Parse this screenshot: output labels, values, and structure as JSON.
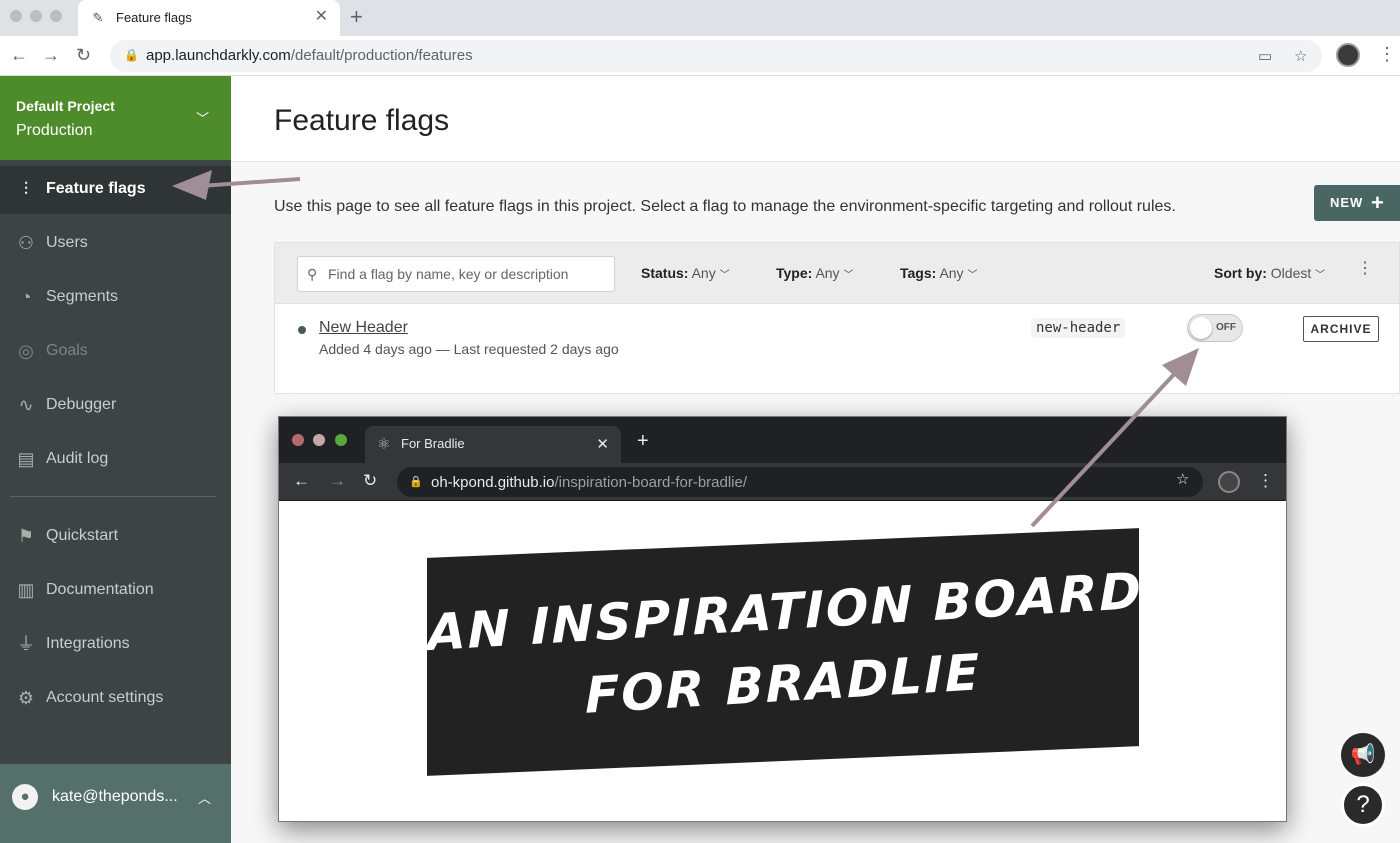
{
  "browser": {
    "tab_title": "Feature flags",
    "tab_close": "✕",
    "new_tab": "+",
    "url_host": "app.launchdarkly.com",
    "url_path": "/default/production/features"
  },
  "sidebar": {
    "project_name": "Default Project",
    "environment": "Production",
    "items": [
      {
        "label": "Feature flags",
        "icon": "sliders-icon"
      },
      {
        "label": "Users",
        "icon": "users-icon"
      },
      {
        "label": "Segments",
        "icon": "pie-chart-icon"
      },
      {
        "label": "Goals",
        "icon": "target-icon"
      },
      {
        "label": "Debugger",
        "icon": "pulse-icon"
      },
      {
        "label": "Audit log",
        "icon": "audit-icon"
      },
      {
        "label": "Quickstart",
        "icon": "signpost-icon"
      },
      {
        "label": "Documentation",
        "icon": "book-icon"
      },
      {
        "label": "Integrations",
        "icon": "plug-icon"
      },
      {
        "label": "Account settings",
        "icon": "gear-icon"
      }
    ],
    "user_email": "kate@theponds..."
  },
  "main": {
    "title": "Feature flags",
    "description": "Use this page to see all feature flags in this project. Select a flag to manage the environment-specific targeting and rollout rules.",
    "new_button": "NEW",
    "search_placeholder": "Find a flag by name, key or description",
    "filters": {
      "status_label": "Status:",
      "status_value": "Any",
      "type_label": "Type:",
      "type_value": "Any",
      "tags_label": "Tags:",
      "tags_value": "Any",
      "sort_label": "Sort by:",
      "sort_value": "Oldest"
    },
    "flag": {
      "name": "New Header",
      "meta": "Added 4 days ago — Last requested 2 days ago",
      "key": "new-header",
      "toggle_state": "OFF",
      "archive_label": "ARCHIVE"
    }
  },
  "preview": {
    "tab_title": "For Bradlie",
    "tab_close": "✕",
    "new_tab": "+",
    "url_host": "oh-kpond.github.io",
    "url_path": "/inspiration-board-for-bradlie/",
    "banner_line1": "AN INSPIRATION BOARD",
    "banner_line2": "FOR BRADLIE"
  },
  "colors": {
    "sidebar_bg": "#3d4544",
    "project_bg": "#4d8b2b",
    "new_button_bg": "#4a6663",
    "annotation_arrow": "#a08d96"
  }
}
